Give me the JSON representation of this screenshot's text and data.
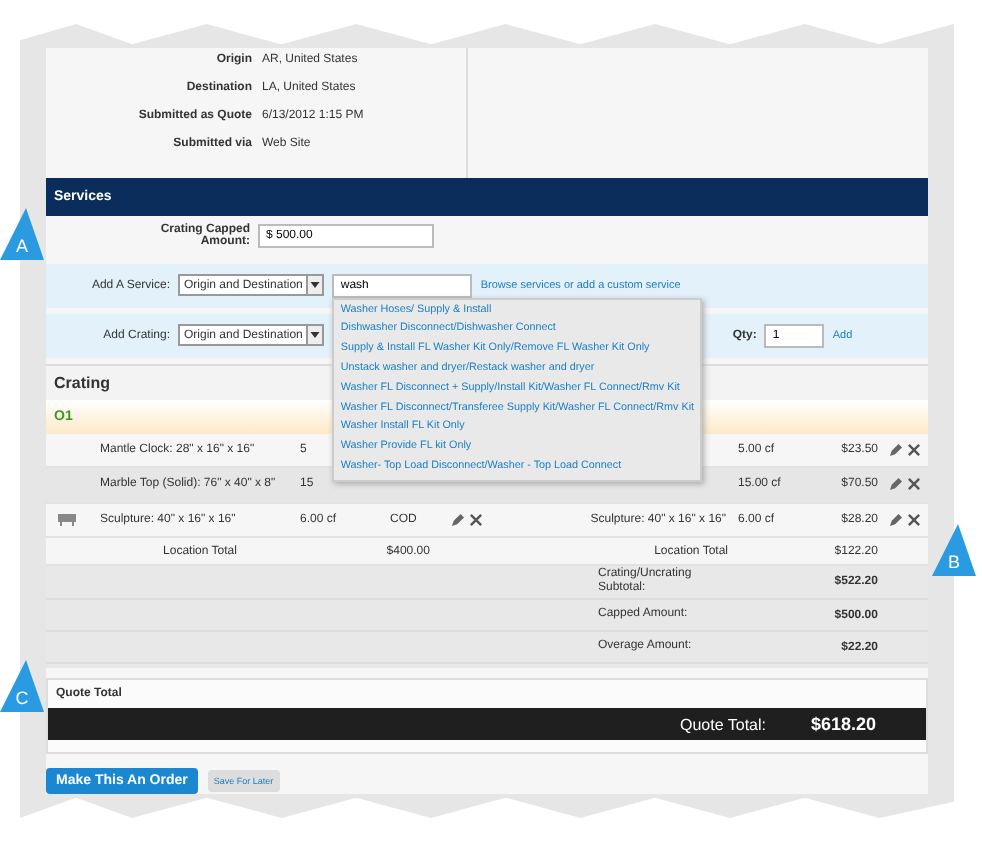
{
  "info": [
    {
      "label": "Origin",
      "value": "AR, United States"
    },
    {
      "label": "Destination",
      "value": "LA, United States"
    },
    {
      "label": "Submitted as Quote",
      "value": "6/13/2012 1:15 PM"
    },
    {
      "label": "Submitted via",
      "value": "Web Site"
    }
  ],
  "services": {
    "title": "Services",
    "capped_label": "Crating Capped Amount:",
    "capped_value": "$ 500.00",
    "add_service": {
      "label": "Add A Service:",
      "select_value": "Origin and Destination",
      "search_value": "wash",
      "link": "Browse services or add a custom service"
    },
    "suggestions": [
      "Washer Hoses/ Supply & Install",
      "Dishwasher Disconnect/Dishwasher Connect",
      "Supply & Install FL Washer Kit Only/Remove FL Washer Kit Only",
      "Unstack washer and dryer/Restack washer and dryer",
      "Washer FL Disconnect + Supply/Install Kit/Washer FL Connect/Rmv Kit",
      "Washer FL Disconnect/Transferee Supply Kit/Washer FL Connect/Rmv Kit",
      "Washer Install FL Kit Only",
      "Washer Provide FL kit Only",
      "Washer- Top Load Disconnect/Washer - Top Load Connect"
    ],
    "add_crating": {
      "label": "Add Crating:",
      "select_value": "Origin and Destination",
      "qty_label": "Qty:",
      "qty_value": "1",
      "add_link": "Add"
    }
  },
  "crating": {
    "title": "Crating",
    "location": "O1",
    "rows": [
      {
        "has_icon": false,
        "name": "Mantle Clock: 28\" x 16\" x 16\"",
        "volume": "5",
        "payment": "",
        "left_actions": false,
        "dest_name": "",
        "dest_volume": "5.00 cf",
        "dest_price": "$23.50"
      },
      {
        "has_icon": false,
        "name": "Marble Top (Solid): 76\" x 40\" x 8\"",
        "volume": "15",
        "payment": "",
        "left_actions": false,
        "dest_name": "",
        "dest_volume": "15.00 cf",
        "dest_price": "$70.50"
      },
      {
        "has_icon": true,
        "name": "Sculpture: 40\" x 16\" x 16\"",
        "volume": "6.00 cf",
        "payment": "COD",
        "left_actions": true,
        "dest_name": "Sculpture: 40\" x 16\" x 16\"",
        "dest_volume": "6.00 cf",
        "dest_price": "$28.20"
      }
    ],
    "location_total": {
      "label": "Location Total",
      "value": "$400.00",
      "dest_label": "Location Total",
      "dest_value": "$122.20"
    },
    "summary": [
      {
        "label": "Crating/Uncrating Subtotal:",
        "value": "$522.20"
      },
      {
        "label": "Capped Amount:",
        "value": "$500.00"
      },
      {
        "label": "Overage Amount:",
        "value": "$22.20"
      }
    ]
  },
  "quote_total": {
    "title": "Quote Total",
    "label": "Quote Total:",
    "value": "$618.20"
  },
  "buttons": [
    {
      "label": "Make This An Order",
      "kind": "primary"
    },
    {
      "label": "Save For Later",
      "kind": "secondary"
    }
  ],
  "callouts": [
    {
      "letter": "A"
    },
    {
      "letter": "B"
    },
    {
      "letter": "C"
    }
  ]
}
